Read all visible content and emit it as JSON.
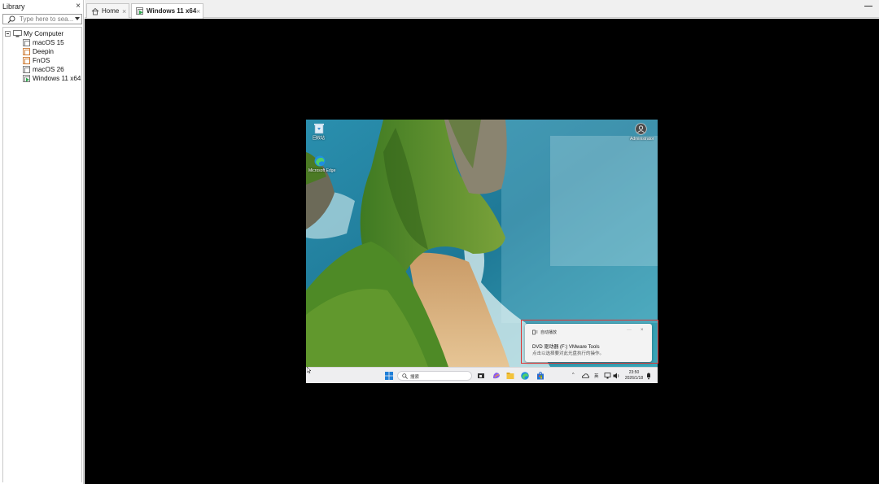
{
  "library": {
    "title": "Library",
    "close": "×",
    "search_placeholder": "Type here to sea...",
    "root_label": "My Computer",
    "items": [
      {
        "label": "macOS 15",
        "running": false
      },
      {
        "label": "Deepin",
        "running": false
      },
      {
        "label": "FnOS",
        "running": false
      },
      {
        "label": "macOS 26",
        "running": false
      },
      {
        "label": "Windows 11 x64",
        "running": true
      }
    ]
  },
  "tabs": [
    {
      "label": "Home",
      "icon": "home-icon",
      "close": "×",
      "active": false
    },
    {
      "label": "Windows 11 x64",
      "icon": "vm-running-icon",
      "close": "×",
      "active": true
    }
  ],
  "guest": {
    "desktop_icons": [
      {
        "name": "recycle-bin-icon",
        "label": "回收站"
      },
      {
        "name": "edge-icon",
        "label": "Microsoft Edge"
      },
      {
        "name": "user-folder-icon",
        "label": "Administrator"
      }
    ],
    "notification": {
      "app": "自动播放",
      "more": "···",
      "close": "×",
      "title": "DVD 驱动器 (F:) VMware Tools",
      "body": "点击以选择要对此光盘执行的操作。"
    },
    "taskbar": {
      "search_text": "搜索",
      "tray_chevron": "^",
      "ime_label": "英",
      "time": "23:50",
      "date": "2026/1/18"
    }
  },
  "colors": {
    "highlight": "#e03030",
    "sea": "#1e7896",
    "cliff": "#5a8a2c",
    "sand": "#d8b07a"
  }
}
